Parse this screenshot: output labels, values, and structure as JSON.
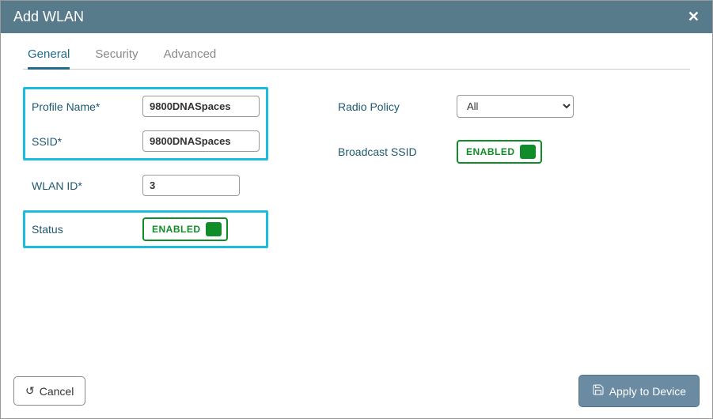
{
  "modal": {
    "title": "Add WLAN"
  },
  "tabs": {
    "general": "General",
    "security": "Security",
    "advanced": "Advanced"
  },
  "labels": {
    "profile_name": "Profile Name*",
    "ssid": "SSID*",
    "wlan_id": "WLAN ID*",
    "status": "Status",
    "radio_policy": "Radio Policy",
    "broadcast_ssid": "Broadcast SSID"
  },
  "fields": {
    "profile_name": "9800DNASpaces",
    "ssid": "9800DNASpaces",
    "wlan_id": "3",
    "status_label": "ENABLED",
    "radio_policy_value": "All",
    "broadcast_ssid_label": "ENABLED"
  },
  "footer": {
    "cancel": "Cancel",
    "apply": "Apply to Device"
  }
}
